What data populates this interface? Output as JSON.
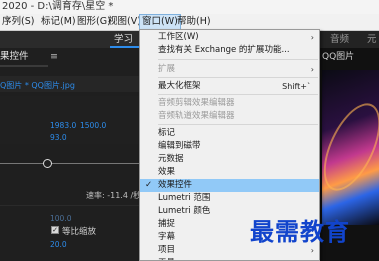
{
  "title_bar": {
    "title": "2020 - D:\\调育存\\星空 *"
  },
  "menu_bar": {
    "items": [
      "序列(S)",
      "标记(M)",
      "图形(G)",
      "视图(V)",
      "窗口(W)",
      "帮助(H)"
    ],
    "active": "窗口(W)"
  },
  "workspace_bar": {
    "left_label": "学习",
    "right_label": "音频",
    "right_tab": "元"
  },
  "left_panel": {
    "tab_label": "果控件",
    "tab_menu": "≡",
    "clip_label": "Q图片 * QQ图片.jpg",
    "values": {
      "v1": "1983.0",
      "v2": "1500.0",
      "v3": "93.0",
      "v4": "100.0",
      "v5": "20.0"
    },
    "rate_text": "速率: -11.4 /秒",
    "checkbox_label": "等比缩放",
    "checkbox_checked": true
  },
  "right_panel": {
    "tab_label": "QQ图片"
  },
  "dropdown": {
    "items": [
      {
        "label": "工作区(W)",
        "submenu": true,
        "disabled": false,
        "checked": false,
        "shortcut": ""
      },
      {
        "label": "查找有关 Exchange 的扩展功能...",
        "submenu": false,
        "disabled": false,
        "checked": false,
        "shortcut": ""
      },
      {
        "label": "扩展",
        "submenu": true,
        "disabled": true,
        "checked": false,
        "shortcut": ""
      },
      {
        "label": "最大化框架",
        "submenu": false,
        "disabled": false,
        "checked": false,
        "shortcut": "Shift+`"
      },
      {
        "label": "音频剪辑效果编辑器",
        "submenu": false,
        "disabled": true,
        "checked": false,
        "shortcut": ""
      },
      {
        "label": "音频轨道效果编辑器",
        "submenu": false,
        "disabled": true,
        "checked": false,
        "shortcut": ""
      },
      {
        "label": "标记",
        "submenu": false,
        "disabled": false,
        "checked": false,
        "shortcut": ""
      },
      {
        "label": "编辑到磁带",
        "submenu": false,
        "disabled": false,
        "checked": false,
        "shortcut": ""
      },
      {
        "label": "元数据",
        "submenu": false,
        "disabled": false,
        "checked": false,
        "shortcut": ""
      },
      {
        "label": "效果",
        "submenu": false,
        "disabled": false,
        "checked": false,
        "shortcut": ""
      },
      {
        "label": "效果控件",
        "submenu": false,
        "disabled": false,
        "checked": true,
        "shortcut": ""
      },
      {
        "label": "Lumetri 范围",
        "submenu": false,
        "disabled": false,
        "checked": false,
        "shortcut": ""
      },
      {
        "label": "Lumetri 颜色",
        "submenu": false,
        "disabled": false,
        "checked": false,
        "shortcut": ""
      },
      {
        "label": "捕捉",
        "submenu": false,
        "disabled": false,
        "checked": false,
        "shortcut": ""
      },
      {
        "label": "字幕",
        "submenu": false,
        "disabled": false,
        "checked": false,
        "shortcut": ""
      },
      {
        "label": "项目",
        "submenu": true,
        "disabled": false,
        "checked": false,
        "shortcut": ""
      },
      {
        "label": "工具",
        "submenu": false,
        "disabled": false,
        "checked": false,
        "shortcut": ""
      }
    ],
    "highlighted_index": 10
  },
  "watermark": {
    "text": "最需教育"
  },
  "colors": {
    "accent": "#2d8ceb",
    "highlight": "#91c9f7",
    "watermark": "#1144cc"
  }
}
